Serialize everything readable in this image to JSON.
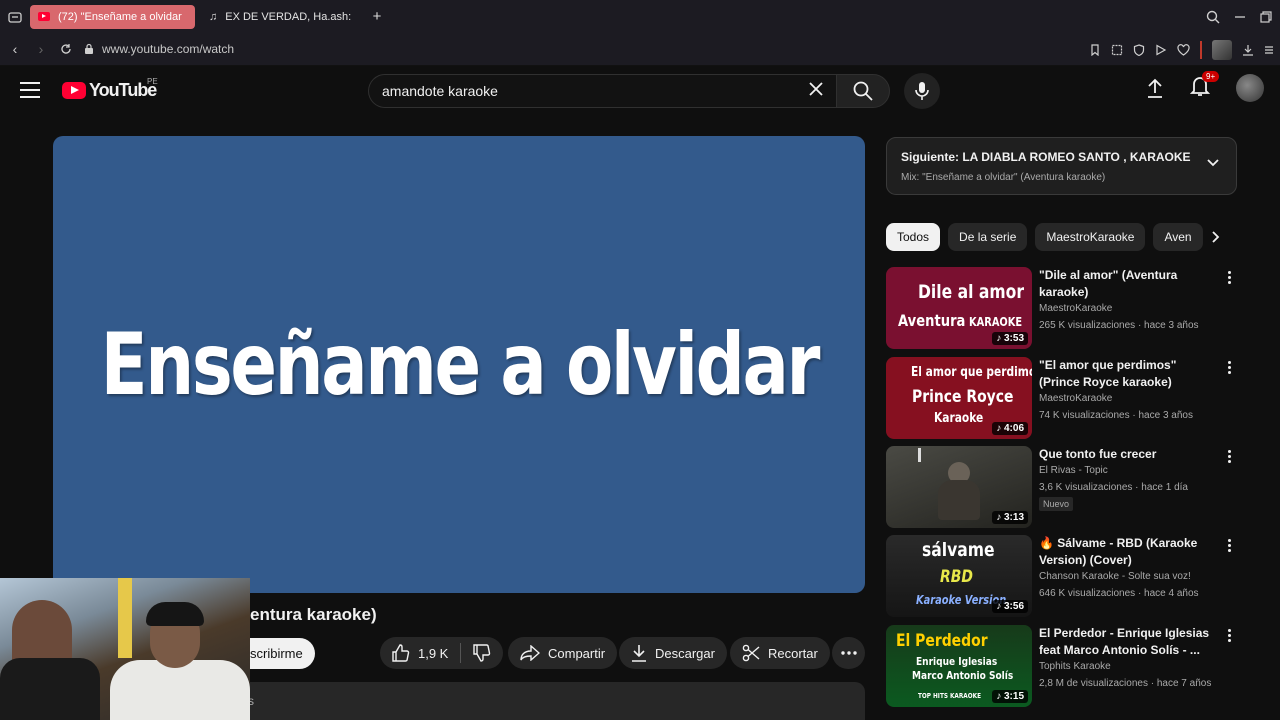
{
  "browser": {
    "tabs": [
      {
        "label": "(72) \"Enseñame a olvidar",
        "active": true
      },
      {
        "label": "EX DE VERDAD, Ha.ash: A",
        "active": false
      }
    ],
    "url": "www.youtube.com/watch"
  },
  "header": {
    "logo_text": "YouTube",
    "country_code": "PE",
    "search_value": "amandote karaoke",
    "notifications_badge": "9+"
  },
  "player": {
    "overlay_text": "Enseñame a olvidar"
  },
  "video": {
    "title_visible": "entura karaoke)",
    "subscribe_label": "scribirme",
    "like_count": "1,9 K",
    "share_label": "Compartir",
    "download_label": "Descargar",
    "clip_label": "Recortar",
    "desc_fragment": "s"
  },
  "next_up": {
    "title": "Siguiente: LA DIABLA ROMEO SANTO , KARAOKE",
    "subtitle": "Mix: \"Enseñame a olvidar\" (Aventura karaoke)"
  },
  "chips": [
    "Todos",
    "De la serie",
    "MaestroKaraoke",
    "Aven"
  ],
  "recommendations": [
    {
      "title": "\"Dile al amor\" (Aventura karaoke)",
      "channel": "MaestroKaraoke",
      "meta": "265 K visualizaciones · hace 3 años",
      "duration": "3:53",
      "thumb_text": [
        "Dile al amor",
        "Aventura",
        "KARAOKE"
      ]
    },
    {
      "title": "\"El amor que perdimos\" (Prince Royce karaoke)",
      "channel": "MaestroKaraoke",
      "meta": "74 K visualizaciones · hace 3 años",
      "duration": "4:06",
      "thumb_text": [
        "El amor que perdimos",
        "Prince Royce",
        "Karaoke"
      ]
    },
    {
      "title": "Que tonto fue crecer",
      "channel": "El Rivas - Topic",
      "meta": "3,6 K visualizaciones · hace 1 día",
      "duration": "3:13",
      "badge": "Nuevo"
    },
    {
      "title": "🔥 Sálvame - RBD (Karaoke Version) (Cover)",
      "channel": "Chanson Karaoke - Solte sua voz!",
      "meta": "646 K visualizaciones · hace 4 años",
      "duration": "3:56",
      "thumb_text": [
        "sálvame",
        "RBD",
        "Karaoke Version"
      ]
    },
    {
      "title": "El Perdedor - Enrique Iglesias feat Marco Antonio Solís - ...",
      "channel": "Tophits Karaoke",
      "meta": "2,8 M de visualizaciones · hace 7 años",
      "duration": "3:15",
      "thumb_text": [
        "El Perdedor",
        "Enrique Iglesias",
        "Marco Antonio Solís",
        "TOP HITS KARAOKE"
      ]
    }
  ],
  "colors": {
    "brand": "#ff0033",
    "background": "#0f0f0f",
    "player_bg": "#335a8c",
    "active_tab": "#d8686d"
  }
}
